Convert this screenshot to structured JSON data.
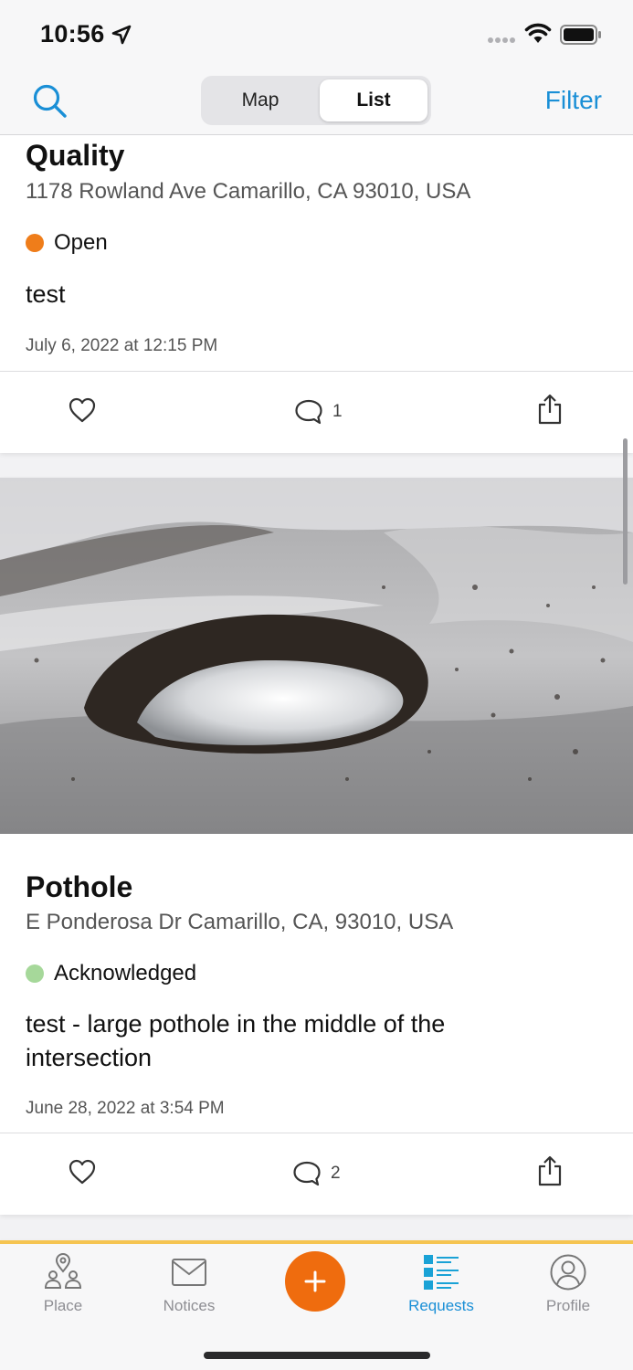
{
  "status_bar": {
    "time": "10:56"
  },
  "nav": {
    "segments": [
      "Map",
      "List"
    ],
    "selected_segment": "List",
    "filter_label": "Filter"
  },
  "requests": [
    {
      "title": "Quality",
      "address": "1178 Rowland Ave Camarillo, CA 93010, USA",
      "status": "Open",
      "status_color": "#ef7d1a",
      "description": "test",
      "date": "July 6, 2022 at 12:15 PM",
      "comment_count": "1"
    },
    {
      "title": "Pothole",
      "address": "E Ponderosa Dr Camarillo, CA, 93010, USA",
      "status": "Acknowledged",
      "status_color": "#a6d89a",
      "description": "test - large pothole in the middle of the intersection",
      "date": "June 28, 2022 at 3:54 PM",
      "comment_count": "2"
    }
  ],
  "tabs": [
    {
      "label": "Place",
      "icon": "place-icon"
    },
    {
      "label": "Notices",
      "icon": "mail-icon"
    },
    {
      "label": "Requests",
      "icon": "list-icon",
      "active": true
    },
    {
      "label": "Profile",
      "icon": "profile-icon"
    }
  ],
  "colors": {
    "accent": "#1a8fd6",
    "add_button": "#ef6c0e",
    "tab_bar_border": "#f5c451"
  }
}
